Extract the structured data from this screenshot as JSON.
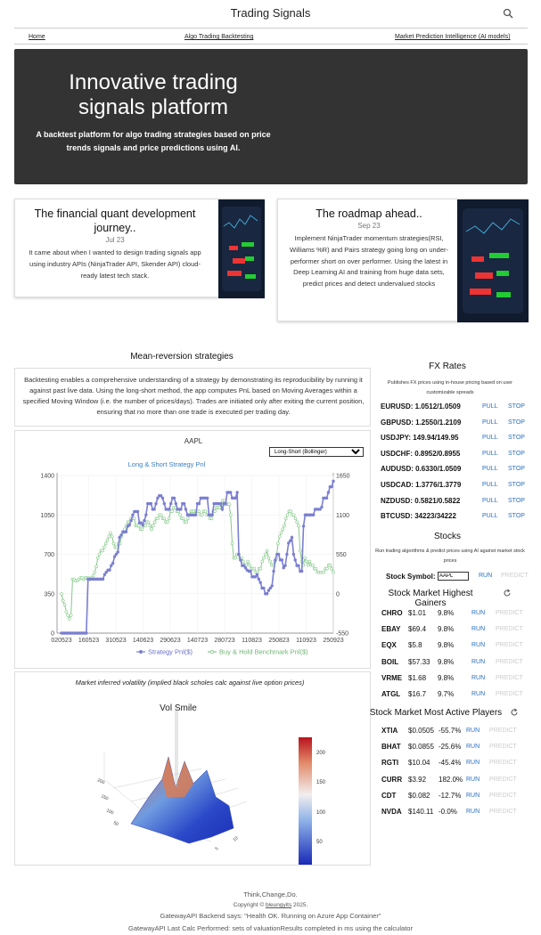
{
  "header": {
    "title": "Trading Signals"
  },
  "nav": {
    "home": "Home",
    "algo": "Algo Trading Backtesting",
    "market": "Market Prediction Intelligence (AI models)"
  },
  "hero": {
    "title": "Innovative trading signals platform",
    "subtitle": "A backtest platform for algo trading strategies based on price trends signals and price predictions using AI."
  },
  "cards": [
    {
      "title": "The financial quant development journey..",
      "date": "Jul 23",
      "text": "It came about when I wanted to design trading signals app using industry APIs (NinjaTrader API, Skender API) cloud-ready latest tech stack."
    },
    {
      "title": "The roadmap ahead..",
      "date": "Sep 23",
      "text": "Implement NinjaTrader momentum strategies(RSI, Williams %R) and Pairs strategy going long on under-performer short on over performer. Using the latest in Deep Learning AI and training from huge data sets, predict prices and detect undervalued stocks"
    }
  ],
  "strategies": {
    "heading": "Mean-reversion strategies",
    "description": "Backtesting enables a comprehensive understanding of a strategy by demonstrating its reproducibility by running it against past live data. Using the long-short method, the app computes PnL based on Moving Averages within a specified Moving Window (i.e. the number of prices/days). Trades are initiated only after exiting the current position, ensuring that no more than one trade is executed per trading day.",
    "strategy_select": "Long-Short (Bollinger)"
  },
  "chart_data": [
    {
      "type": "line",
      "title": "AAPL",
      "subtitle": "Long & Short Strategy Pnl",
      "x_ticks": [
        "020523",
        "160523",
        "310523",
        "140623",
        "290623",
        "140723",
        "280723",
        "110823",
        "250823",
        "110923",
        "250923"
      ],
      "y_left_ticks": [
        "0",
        "350",
        "700",
        "1050",
        "1400"
      ],
      "y_right_ticks": [
        "-550",
        "0",
        "550",
        "1100",
        "1650"
      ],
      "ylim_left": [
        0,
        1400
      ],
      "ylim_right": [
        -550,
        1650
      ],
      "series": [
        {
          "name": "Strategy Pnl($)",
          "color": "#7b7fd1",
          "axis": "left",
          "values": [
            0,
            0,
            0,
            0,
            0,
            0,
            0,
            0,
            0,
            0,
            0,
            0,
            0,
            0,
            0,
            0,
            480,
            480,
            480,
            480,
            480,
            480,
            480,
            480,
            480,
            480,
            520,
            540,
            560,
            560,
            600,
            620,
            680,
            700,
            720,
            850,
            870,
            900,
            900,
            900,
            950,
            960,
            1000,
            1050,
            1080,
            1080,
            1080,
            980,
            980,
            960,
            1000,
            1050,
            1150,
            1150,
            1150,
            1100,
            1100,
            1150,
            1200,
            1220,
            1220,
            1200,
            1150,
            1100,
            1100,
            1100,
            1150,
            1200,
            1200,
            1150,
            1100,
            1100,
            1100,
            1150,
            1150,
            1100,
            1050,
            1050,
            1050,
            1050,
            1050,
            1050,
            1150,
            1150,
            1200,
            1200,
            1200,
            1200,
            1200,
            1050,
            1050,
            1050,
            1150,
            1150,
            1150,
            1150,
            1150,
            1100,
            1150,
            1150,
            1250,
            1250,
            1250,
            1200,
            1200,
            1200,
            1250,
            700,
            650,
            600,
            600,
            580,
            560,
            550,
            550,
            500,
            500,
            500,
            520,
            480,
            450,
            400,
            400,
            350,
            350,
            380,
            400,
            420,
            550,
            650,
            700,
            700,
            650,
            650,
            580,
            600,
            700,
            800,
            820,
            850,
            700,
            650,
            600,
            600,
            550,
            550,
            950,
            1050,
            1050,
            1050,
            1050,
            1050,
            1050,
            1100,
            1100,
            1100,
            1100,
            1120,
            1200,
            1200,
            1200,
            1250,
            1300,
            1300,
            1350
          ]
        },
        {
          "name": "Buy & Hold Benchmark Pnl($)",
          "color": "#86c98a",
          "axis": "right",
          "values": [
            0,
            -100,
            -150,
            -250,
            -300,
            -350,
            -300,
            200,
            200,
            180,
            180,
            200,
            220,
            220,
            200,
            220,
            220,
            220,
            200,
            220,
            250,
            300,
            380,
            500,
            550,
            600,
            600,
            650,
            700,
            750,
            800,
            850,
            800,
            700,
            650,
            650,
            700,
            700,
            800,
            850,
            900,
            950,
            1000,
            1000,
            1050,
            1050,
            1050,
            950,
            950,
            950,
            900,
            900,
            950,
            950,
            1000,
            1000,
            950,
            900,
            950,
            1000,
            1050,
            1050,
            1100,
            1100,
            1050,
            1050,
            1000,
            1000,
            1050,
            1150,
            1150,
            1200,
            1200,
            1150,
            1150,
            1100,
            1050,
            1050,
            1000,
            1000,
            1050,
            1100,
            1150,
            1150,
            1150,
            1150,
            1150,
            1150,
            1100,
            1100,
            1150,
            1150,
            1100,
            1100,
            1050,
            1050,
            1150,
            1150,
            1200,
            1200,
            1200,
            1250,
            1300,
            1300,
            1250,
            1250,
            1250,
            1100,
            700,
            500,
            500,
            550,
            550,
            500,
            500,
            450,
            400,
            400,
            450,
            400,
            350,
            350,
            350,
            300,
            300,
            350,
            350,
            450,
            500,
            550,
            600,
            500,
            450,
            400,
            400,
            450,
            500,
            700,
            800,
            850,
            900,
            950,
            1050,
            1100,
            1150,
            1150,
            1100,
            1100,
            1050,
            1000,
            950,
            600,
            450,
            400,
            500,
            450,
            400,
            450,
            400,
            400,
            350,
            350,
            300,
            300,
            300,
            300,
            300,
            350,
            350,
            400,
            400,
            350,
            300
          ]
        }
      ]
    }
  ],
  "vol": {
    "header": "Market inferred volatility (implied black scholes calc against live option prices)",
    "title": "Vol Smile",
    "colorbar_ticks": [
      "200",
      "150",
      "100",
      "50"
    ]
  },
  "fx": {
    "heading": "FX Rates",
    "note": "Publishes FX prices using in-house pricing based on user customizable spreads",
    "pull": "PULL",
    "stop": "STOP",
    "rows": [
      {
        "pair": "EURUSD: 1.0512/1.0509"
      },
      {
        "pair": "GBPUSD: 1.2550/1.2109"
      },
      {
        "pair": "USDJPY: 149.94/149.95"
      },
      {
        "pair": "USDCHF: 0.8952/0.8955"
      },
      {
        "pair": "AUDUSD: 0.6330/1.0509"
      },
      {
        "pair": "USDCAD: 1.3776/1.3779"
      },
      {
        "pair": "NZDUSD: 0.5821/0.5822"
      },
      {
        "pair": "BTCUSD: 34223/34222"
      }
    ]
  },
  "stocks": {
    "heading": "Stocks",
    "note": "Run trading algorithms & predict prices using AI against market stock prices",
    "symbol_label": "Stock Symbol:",
    "symbol_value": "AAPL",
    "run": "RUN",
    "predict": "PREDICT"
  },
  "gainers": {
    "heading": "Stock Market Highest Gainers",
    "rows": [
      {
        "sym": "CHRO",
        "price": "$1.01",
        "pct": "9.8%"
      },
      {
        "sym": "EBAY",
        "price": "$69.4",
        "pct": "9.8%"
      },
      {
        "sym": "EQX",
        "price": "$5.8",
        "pct": "9.8%"
      },
      {
        "sym": "BOIL",
        "price": "$57.33",
        "pct": "9.8%"
      },
      {
        "sym": "VRME",
        "price": "$1.68",
        "pct": "9.8%"
      },
      {
        "sym": "ATGL",
        "price": "$16.7",
        "pct": "9.7%"
      }
    ]
  },
  "active": {
    "heading": "Stock Market Most Active Players",
    "rows": [
      {
        "sym": "XTIA",
        "price": "$0.0505",
        "pct": "-55.7%"
      },
      {
        "sym": "BHAT",
        "price": "$0.0855",
        "pct": "-25.6%"
      },
      {
        "sym": "RGTI",
        "price": "$10.04",
        "pct": "-45.4%"
      },
      {
        "sym": "CURR",
        "price": "$3.92",
        "pct": "182.0%"
      },
      {
        "sym": "CDT",
        "price": "$0.082",
        "pct": "-12.7%"
      },
      {
        "sym": "NVDA",
        "price": "$140.11",
        "pct": "-0.0%"
      }
    ]
  },
  "footer": {
    "tagline": "Think,Change,Do.",
    "copyright_pre": "Copyright © ",
    "author": "bleungyits",
    "copyright_post": " 2025.",
    "health": "GatewayAPI Backend says: \"Health OK. Running on Azure App Container\"",
    "lastcalc": "GatewayAPI Last Calc Performed: sets of valuationResults completed in ms using the calculator"
  }
}
